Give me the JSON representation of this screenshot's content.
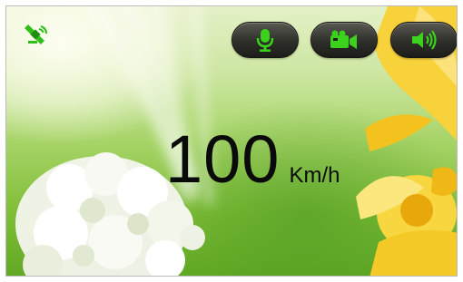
{
  "status": {
    "gps_icon": "satellite-gps-icon",
    "accent_color": "#2fbf18"
  },
  "controls": [
    {
      "name": "microphone",
      "icon": "microphone-icon"
    },
    {
      "name": "camera",
      "icon": "video-camera-icon"
    },
    {
      "name": "volume",
      "icon": "speaker-volume-icon"
    }
  ],
  "speed": {
    "value": "100",
    "unit": "Km/h"
  }
}
